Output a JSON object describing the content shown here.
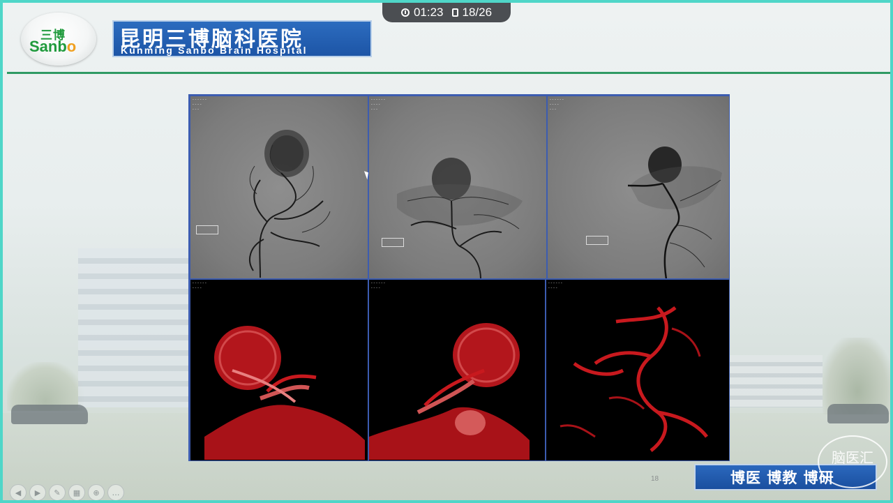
{
  "timer": {
    "elapsed": "01:23",
    "slide": "18/26"
  },
  "logo": {
    "cn": "三博",
    "en_main": "Sanb",
    "en_o": "o"
  },
  "title": {
    "cn": "昆明三博脑科医院",
    "en": "Kunming Sanbo Brain Hospital"
  },
  "motto": "博医 博教 博研",
  "page_number": "18",
  "watermark": {
    "cn": "脑医汇"
  },
  "nav": {
    "buttons": [
      {
        "name": "prev-button",
        "glyph": "◀"
      },
      {
        "name": "next-button",
        "glyph": "▶"
      },
      {
        "name": "pen-button",
        "glyph": "✎"
      },
      {
        "name": "slides-button",
        "glyph": "▦"
      },
      {
        "name": "zoom-button",
        "glyph": "⊕"
      },
      {
        "name": "more-button",
        "glyph": "…"
      }
    ]
  },
  "colors": {
    "frame_border": "#4fd6c8",
    "header_line": "#2f9a63",
    "banner_blue": "#1d55a6",
    "vessel_red": "#c8191e"
  }
}
